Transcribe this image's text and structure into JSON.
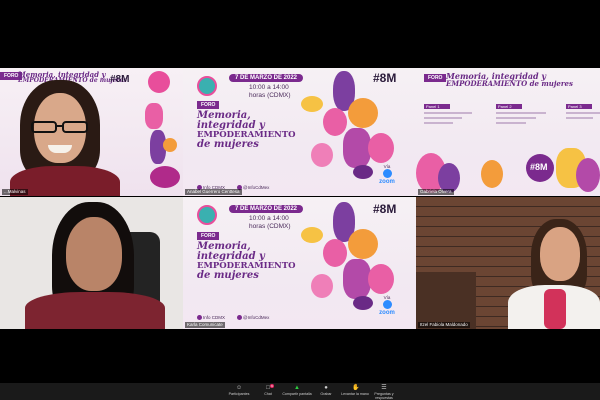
{
  "participants": {
    "top_left": {
      "name": "...Malvinas"
    },
    "top_center": {
      "name": "Anabel Guerrero Centtesa"
    },
    "top_right": {
      "name": "Gabriela Olvera"
    },
    "bottom_left": {
      "name": ""
    },
    "bottom_center": {
      "name": "Karla Comunicate"
    },
    "bottom_right": {
      "name": "Itzel Fabiola Maldonado"
    }
  },
  "poster": {
    "hashtag": "#8M",
    "date": "7 DE MARZO DE 2022",
    "time_line1": "10:00 a 14:00",
    "time_line2": "horas (CDMX)",
    "foro": "FORO",
    "title_line1": "Memoria,",
    "title_line2": "integridad y",
    "title_line3": "EMPODERAMIENTO",
    "title_line4": "de mujeres",
    "social1": "Info CDMX",
    "social2": "@InfoCdMex",
    "via": "Vía",
    "zoom": "zoom"
  },
  "left_poster": {
    "foro": "FORO",
    "title_line1": "Memoria, integridad y",
    "title_line2": "EMPODERAMIENTO de mujeres",
    "hashtag": "#8M"
  },
  "right_poster": {
    "foro": "FORO",
    "title_line1": "Memoria, integridad y",
    "title_line2": "EMPODERAMIENTO de mujeres",
    "panel1": "Panel 1",
    "panel2": "Panel 2",
    "panel3": "Panel 3",
    "hashtag": "#8M"
  },
  "toolbar": {
    "participants": "Participantes",
    "chat": "Chat",
    "chat_badge": "9",
    "share": "Compartir pantalla",
    "record": "Grabar",
    "raise_hand": "Levantar la mano",
    "qa": "Preguntas y respuestas"
  },
  "colors": {
    "accent_purple": "#7b2a8e",
    "active_speaker": "#e8e43a",
    "zoom_blue": "#2d8cff",
    "share_green": "#2ecc40"
  }
}
